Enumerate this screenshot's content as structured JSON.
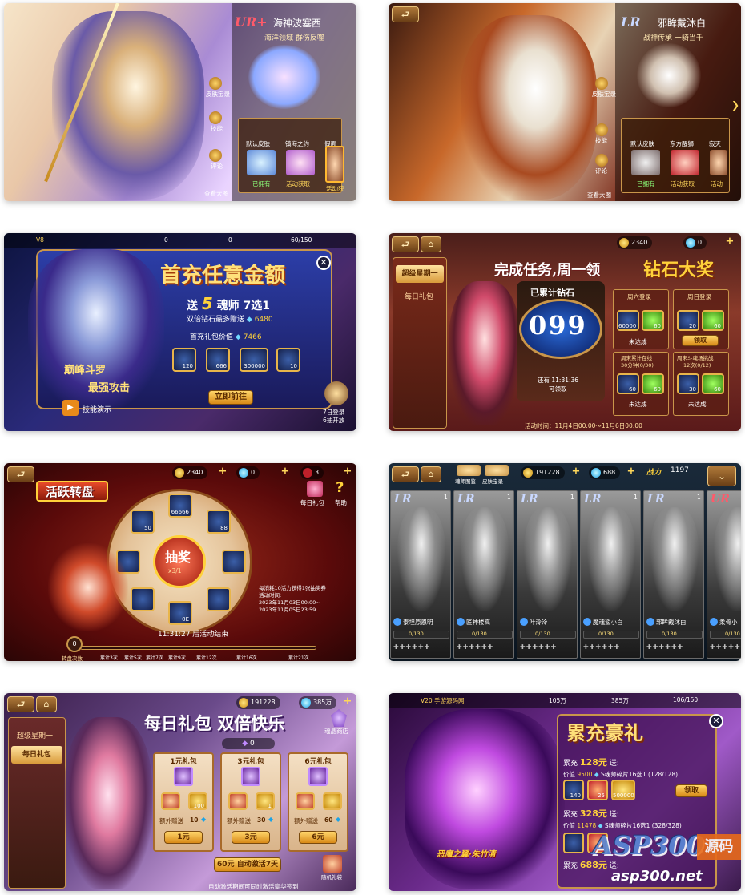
{
  "card1": {
    "badge": "UR+",
    "hero_name": "海神波塞西",
    "subtitle": "海洋领域  群伤反噬",
    "side_menu": [
      "皮肤宝录",
      "技能",
      "评论",
      "查看大图"
    ],
    "skins": [
      {
        "label": "默认皮肤",
        "status": "已拥有"
      },
      {
        "label": "镇海之约",
        "status": "活动获取"
      },
      {
        "label": "假面",
        "status": "活动获"
      }
    ]
  },
  "card2": {
    "badge": "LR",
    "hero_name": "邪眸戴沐白",
    "subtitle": "战神传承  一骑当千",
    "side_menu": [
      "皮肤宝录",
      "技能",
      "评论",
      "查看大图"
    ],
    "skins": [
      {
        "label": "默认皮肤",
        "status": "已拥有"
      },
      {
        "label": "东方醒狮",
        "status": "活动获取"
      },
      {
        "label": "寂灭",
        "status": "活动"
      }
    ]
  },
  "card3": {
    "vip": "V8",
    "res": [
      "0",
      "0",
      "60/150"
    ],
    "title": "首充任意金额",
    "send_prefix": "送",
    "send_num": "5",
    "send_suffix": "魂师  7选1",
    "double_text": "双倍钻石最多赠送",
    "double_value": "6480",
    "gift_value_label": "首充礼包价值",
    "gift_value": "7466",
    "items": [
      "120",
      "666",
      "300000",
      "10"
    ],
    "hero_name": "巅峰斗罗",
    "hero_tag": "最强攻击",
    "go_button": "立即前往",
    "skill_demo": "技能演示",
    "login_hint_1": "7日登录",
    "login_hint_2": "6抽开放"
  },
  "card4": {
    "gold": "2340",
    "diamond": "0",
    "tab_active": "超级星期一",
    "tab_other": "每日礼包",
    "title_a": "完成任务,周一领",
    "title_b": "钻石大奖",
    "accum_label": "已累计钻石",
    "accum_value": "099",
    "countdown": "还有 11:31:36",
    "countdown_sub": "可领取",
    "tasks": [
      {
        "title": "周六登录",
        "items": [
          "60000",
          "60"
        ],
        "status": "未达成"
      },
      {
        "title": "周日登录",
        "items": [
          "20",
          "60"
        ],
        "status": "领取"
      },
      {
        "title": "周末累计在线",
        "sub": "30分钟(0/30)",
        "items": [
          "60",
          "60"
        ],
        "status": "未达成"
      },
      {
        "title": "周末斗魂场挑战",
        "sub": "12次(0/12)",
        "items": [
          "30",
          "60"
        ],
        "status": "未达成"
      }
    ],
    "activity_time": "活动时间：11月4日00:00～11月6日00:00"
  },
  "card5": {
    "gold": "2340",
    "diamond": "0",
    "third": "3",
    "title": "活跃转盘",
    "daily_gift": "每日礼包",
    "help": "帮助",
    "spin": "抽奖",
    "spin_sub": "x3/1",
    "wheel_items": [
      "66666",
      "88",
      "",
      "",
      "0E",
      "",
      "",
      "50"
    ],
    "rule_line1": "每消耗10活力获得1张抽奖券",
    "rule_line2": "活动时间:",
    "rule_line3": "2023年11月03日00:00~",
    "rule_line4": "2023年11月05日23:59",
    "countdown": "11:31:27  后活动结束",
    "spin_count_label": "转盘次数",
    "spin_count": "0",
    "milestones": [
      "累计3次",
      "累计5次",
      "累计7次",
      "累计9次",
      "累计12次",
      "累计16次",
      "累计21次"
    ]
  },
  "card6": {
    "tab1": "魂师图鉴",
    "tab2": "皮肤宝录",
    "gold": "191228",
    "diamond": "688",
    "power_label": "战力",
    "power": "1197",
    "heroes": [
      {
        "badge": "LR",
        "name": "泰坦原恩明",
        "progress": "0/130"
      },
      {
        "badge": "LR",
        "name": "匠神楼高",
        "progress": "0/130"
      },
      {
        "badge": "LR",
        "name": "叶泠泠",
        "progress": "0/130"
      },
      {
        "badge": "LR",
        "name": "魔魂鲨小白",
        "progress": "0/130"
      },
      {
        "badge": "LR",
        "name": "邪眸戴沐白",
        "progress": "0/130"
      },
      {
        "badge": "UR",
        "name": "柔骨小",
        "progress": "0/130"
      }
    ],
    "rank": "1"
  },
  "card7": {
    "gold": "191228",
    "diamond": "385万",
    "tab_other": "超级星期一",
    "tab_active": "每日礼包",
    "title": "每日礼包  双倍快乐",
    "shop": "魂晶商店",
    "gem_count": "0",
    "packs": [
      {
        "title": "1元礼包",
        "extra_label": "额外赠送",
        "extra": "10",
        "price": "1元",
        "items": [
          "",
          "100"
        ]
      },
      {
        "title": "3元礼包",
        "extra_label": "额外赠送",
        "extra": "30",
        "price": "3元",
        "items": [
          "",
          "1"
        ]
      },
      {
        "title": "6元礼包",
        "extra_label": "额外赠送",
        "extra": "60",
        "price": "6元",
        "items": [
          "",
          ""
        ]
      }
    ],
    "activate": "60元 自动激活7天",
    "random_gift": "随机礼袋",
    "footer": "自动激活期间可同时激活豪华签到"
  },
  "card8": {
    "vip": "V20 手游源码网",
    "res": [
      "105万",
      "385万",
      "106/150"
    ],
    "title": "累充豪礼",
    "tier1_label": "累充",
    "tier1_amount": "128元",
    "tier1_suffix": "送:",
    "tier1_value_label": "价值",
    "tier1_value": "9500",
    "tier1_desc": "S魂师碎片16选1",
    "tier1_progress": "(128/128)",
    "tier1_items": [
      "140",
      "25",
      "500000"
    ],
    "claim": "领取",
    "tier2_label": "累充",
    "tier2_amount": "328元",
    "tier2_suffix": "送:",
    "tier2_value_label": "价值",
    "tier2_value": "11478",
    "tier2_desc": "S魂师碎片16选1",
    "tier2_progress": "(328/328)",
    "tier3_label": "累充",
    "tier3_amount": "688元",
    "tier3_suffix": "送:",
    "hero_caption": "恶魔之翼·朱竹清",
    "watermark_logo": "ASP300",
    "watermark_cn": "源码",
    "watermark_url": "asp300.net"
  }
}
